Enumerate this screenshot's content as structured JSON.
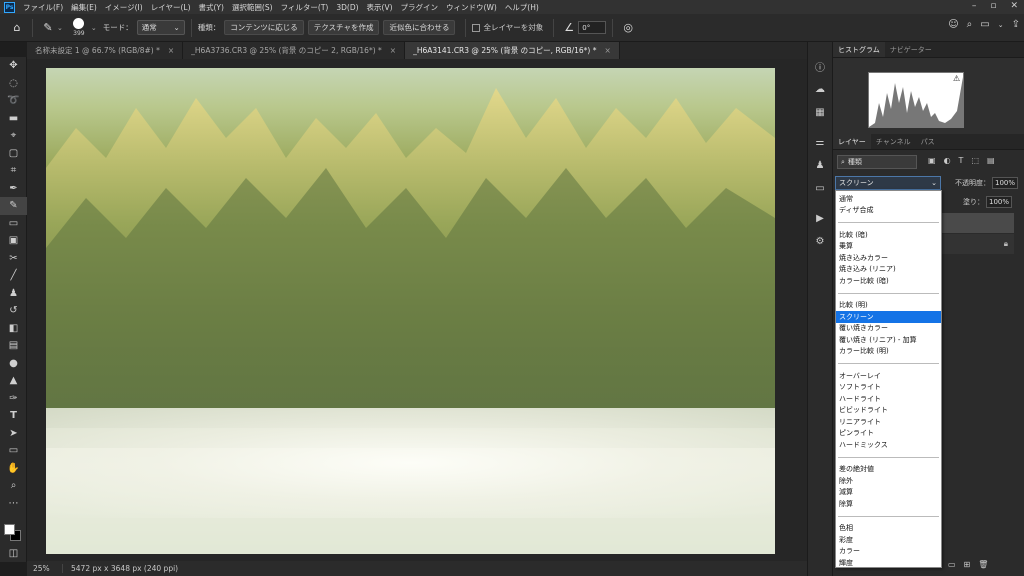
{
  "menubar": {
    "logo": "Ps",
    "items": [
      "ファイル(F)",
      "編集(E)",
      "イメージ(I)",
      "レイヤー(L)",
      "書式(Y)",
      "選択範囲(S)",
      "フィルター(T)",
      "3D(D)",
      "表示(V)",
      "プラグイン",
      "ウィンドウ(W)",
      "ヘルプ(H)"
    ]
  },
  "options": {
    "brush_size": "399",
    "mode_label": "モード：",
    "mode_value": "通常",
    "type_label": "種類：",
    "btn_content": "コンテンツに応じる",
    "btn_texture": "テクスチャを作成",
    "btn_proximity": "近似色に合わせる",
    "all_layers_label": "全レイヤーを対象",
    "angle": "0°"
  },
  "tabs": [
    {
      "label": "名称未設定 1 @ 66.7% (RGB/8#) *"
    },
    {
      "label": "_H6A3736.CR3 @ 25% (背景 のコピー 2, RGB/16*) *"
    },
    {
      "label": "_H6A3141.CR3 @ 25% (背景 のコピー, RGB/16*) *"
    }
  ],
  "statusbar": {
    "zoom": "25%",
    "dimensions": "5472 px x 3648 px (240 ppi)"
  },
  "panels": {
    "top_tabs": [
      "ヒストグラム",
      "ナビゲーター"
    ],
    "layer_tabs": [
      "レイヤー",
      "チャンネル",
      "パス"
    ],
    "search_kind": "種類",
    "blend_mode": "スクリーン",
    "opacity_label": "不透明度：",
    "opacity_value": "100%",
    "fill_label": "塗り：",
    "fill_value": "100%"
  },
  "dropdown": {
    "groups": [
      [
        "通常",
        "ディザ合成"
      ],
      [
        "比較 (暗)",
        "乗算",
        "焼き込みカラー",
        "焼き込み (リニア)",
        "カラー比較 (暗)"
      ],
      [
        "比較 (明)",
        "スクリーン",
        "覆い焼きカラー",
        "覆い焼き (リニア) - 加算",
        "カラー比較 (明)"
      ],
      [
        "オーバーレイ",
        "ソフトライト",
        "ハードライト",
        "ビビッドライト",
        "リニアライト",
        "ピンライト",
        "ハードミックス"
      ],
      [
        "差の絶対値",
        "除外",
        "減算",
        "除算"
      ],
      [
        "色相",
        "彩度",
        "カラー",
        "輝度"
      ]
    ],
    "selected": "スクリーン"
  }
}
